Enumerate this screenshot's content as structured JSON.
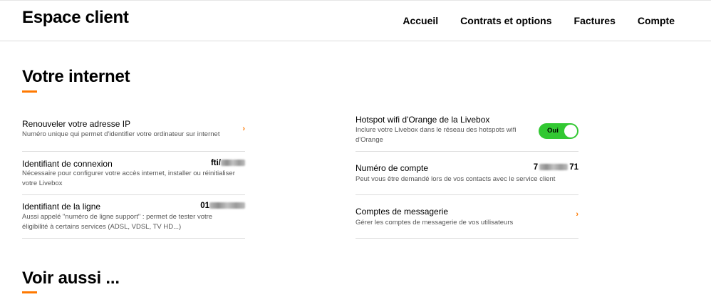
{
  "header": {
    "title": "Espace client",
    "nav": [
      "Accueil",
      "Contrats et options",
      "Factures",
      "Compte"
    ]
  },
  "section1": {
    "title": "Votre internet"
  },
  "section2": {
    "title": "Voir aussi ..."
  },
  "left_rows": [
    {
      "title": "Renouveler votre adresse IP",
      "desc": "Numéro unique qui permet d'identifier votre ordinateur sur internet"
    },
    {
      "title": "Identifiant de connexion",
      "value_visible": "fti/",
      "desc_line1": "Nécessaire pour configurer votre accès internet, installer ou réinitialiser",
      "desc_line2": "votre Livebox"
    },
    {
      "title": "Identifiant de la ligne",
      "value_visible": "01",
      "desc_line1": "Aussi appelé \"numéro de ligne support\" : permet de tester votre",
      "desc_line2": "éligibilité à certains services (ADSL, VDSL, TV HD...)"
    }
  ],
  "right_rows": [
    {
      "title": "Hotspot wifi d'Orange de la Livebox",
      "desc_line1": "Inclure votre Livebox dans le réseau des hotspots wifi",
      "desc_line2": "d'Orange",
      "toggle_label": "Oui",
      "toggle_on": true
    },
    {
      "title": "Numéro de compte",
      "value_start": "7",
      "value_end": "71",
      "desc": "Peut vous être demandé lors de vos contacts avec le service client"
    },
    {
      "title": "Comptes de messagerie",
      "desc": "Gérer les comptes de messagerie de vos utilisateurs"
    }
  ],
  "icons": {
    "chevron": "chevron-right-icon",
    "chevron_glyph": "›"
  },
  "colors": {
    "accent": "#ff7900",
    "toggle_on": "#32c832"
  }
}
